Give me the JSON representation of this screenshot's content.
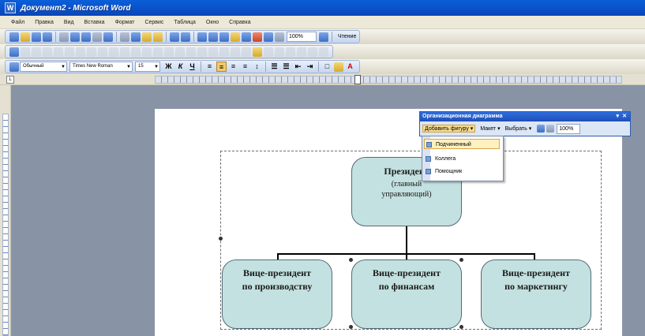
{
  "window": {
    "title": "Документ2 - Microsoft Word"
  },
  "menu": [
    "Файл",
    "Правка",
    "Вид",
    "Вставка",
    "Формат",
    "Сервис",
    "Таблица",
    "Окно",
    "Справка"
  ],
  "standard_toolbar": {
    "zoom": "100%",
    "read_label": "Чтение"
  },
  "formatting_toolbar": {
    "style": "Обычный",
    "font": "Times New Roman",
    "size": "15"
  },
  "org_toolbar": {
    "title": "Организационная диаграмма",
    "insert_shape": "Добавить фигуру",
    "layout": "Макет",
    "select": "Выбрать",
    "zoom": "100%"
  },
  "insert_menu": {
    "items": [
      "Подчиненный",
      "Коллега",
      "Помощник"
    ]
  },
  "diagram": {
    "top": {
      "title": "Президент",
      "subtitle": "(главный управляющий)"
    },
    "children": [
      {
        "line1": "Вице-президент",
        "line2": "по производству"
      },
      {
        "line1": "Вице-президент",
        "line2": "по финансам"
      },
      {
        "line1": "Вице-президент",
        "line2": "по маркетингу"
      }
    ],
    "node_color": "#c3e1e0"
  },
  "colors": {
    "title_bar": "#0b4fc8",
    "toolbar_bg": "#ece9d8",
    "canvas_bg": "#8893a6",
    "highlight": "#f9dc8a"
  }
}
